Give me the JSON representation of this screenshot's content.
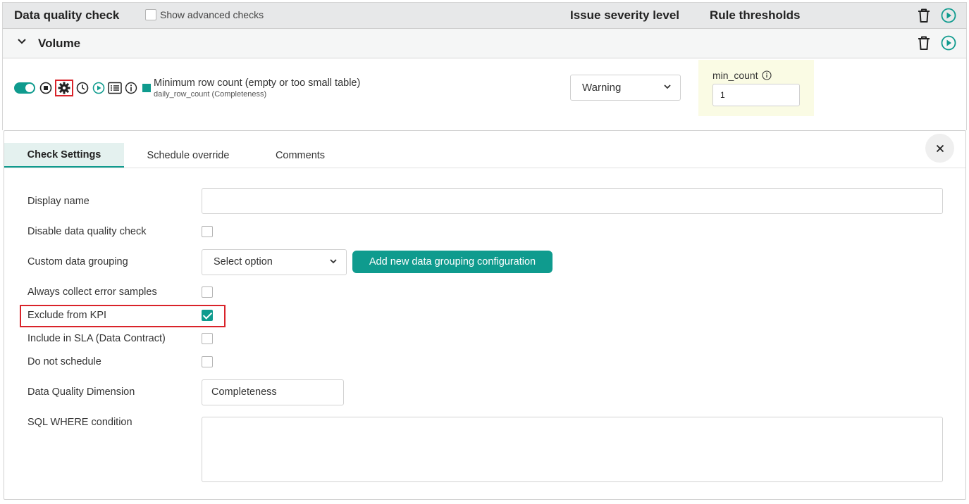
{
  "header": {
    "title": "Data quality check",
    "show_advanced_label": "Show advanced checks",
    "severity_header": "Issue severity level",
    "thresholds_header": "Rule thresholds"
  },
  "category": {
    "name": "Volume"
  },
  "check": {
    "name": "Minimum row count (empty or too small table)",
    "subtitle": "daily_row_count (Completeness)",
    "severity_value": "Warning",
    "threshold_label": "min_count",
    "threshold_value": "1",
    "enabled": true
  },
  "tabs": [
    {
      "label": "Check Settings"
    },
    {
      "label": "Schedule override"
    },
    {
      "label": "Comments"
    }
  ],
  "settings": {
    "display_name_label": "Display name",
    "display_name_value": "",
    "disable_label": "Disable data quality check",
    "grouping_label": "Custom data grouping",
    "grouping_select": "Select option",
    "add_grouping_button": "Add new data grouping configuration",
    "always_collect_label": "Always collect error samples",
    "exclude_kpi_label": "Exclude from KPI",
    "include_sla_label": "Include in SLA (Data Contract)",
    "do_not_schedule_label": "Do not schedule",
    "dimension_label": "Data Quality Dimension",
    "dimension_value": "Completeness",
    "sql_where_label": "SQL WHERE condition",
    "sql_where_value": ""
  },
  "colors": {
    "accent": "#0f9b8e",
    "highlight": "#d9232a",
    "threshold_bg": "#fafbe4"
  }
}
